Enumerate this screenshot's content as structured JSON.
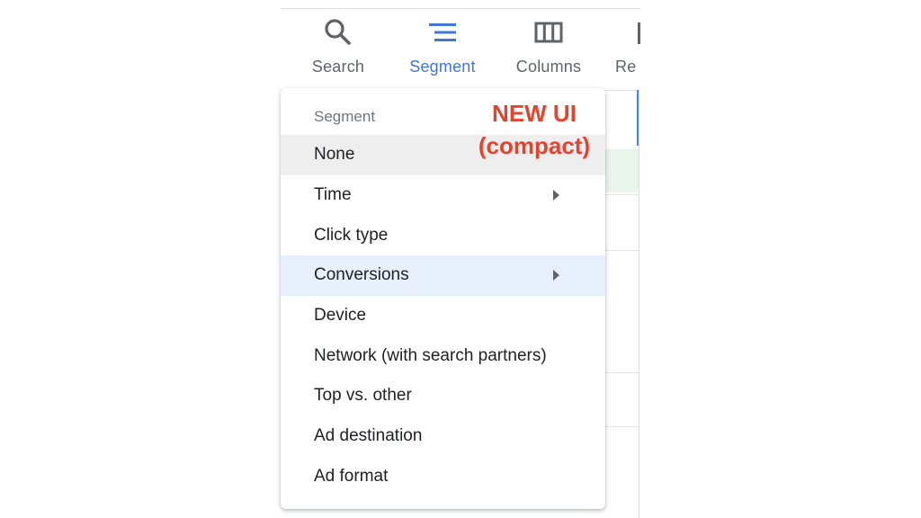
{
  "toolbar": {
    "buttons": [
      {
        "label": "Search",
        "icon": "search-icon"
      },
      {
        "label": "Segment",
        "icon": "segment-icon",
        "active": true
      },
      {
        "label": "Columns",
        "icon": "columns-icon"
      },
      {
        "label": "Re",
        "icon": "reports-icon"
      }
    ]
  },
  "menu": {
    "header": "Segment",
    "items": [
      {
        "label": "None",
        "state": "hover"
      },
      {
        "label": "Time",
        "has_submenu": true
      },
      {
        "label": "Click type"
      },
      {
        "label": "Conversions",
        "has_submenu": true,
        "state": "selected"
      },
      {
        "label": "Device"
      },
      {
        "label": "Network (with search partners)"
      },
      {
        "label": "Top vs. other"
      },
      {
        "label": "Ad destination"
      },
      {
        "label": "Ad format"
      }
    ]
  },
  "annotation": {
    "line1": "NEW UI",
    "line2": "(compact)"
  },
  "colors": {
    "active_accent": "#3c78d8",
    "annotation": "#e5432d",
    "hover_bg": "#eeeeee",
    "selected_bg": "#e8f0fe"
  }
}
